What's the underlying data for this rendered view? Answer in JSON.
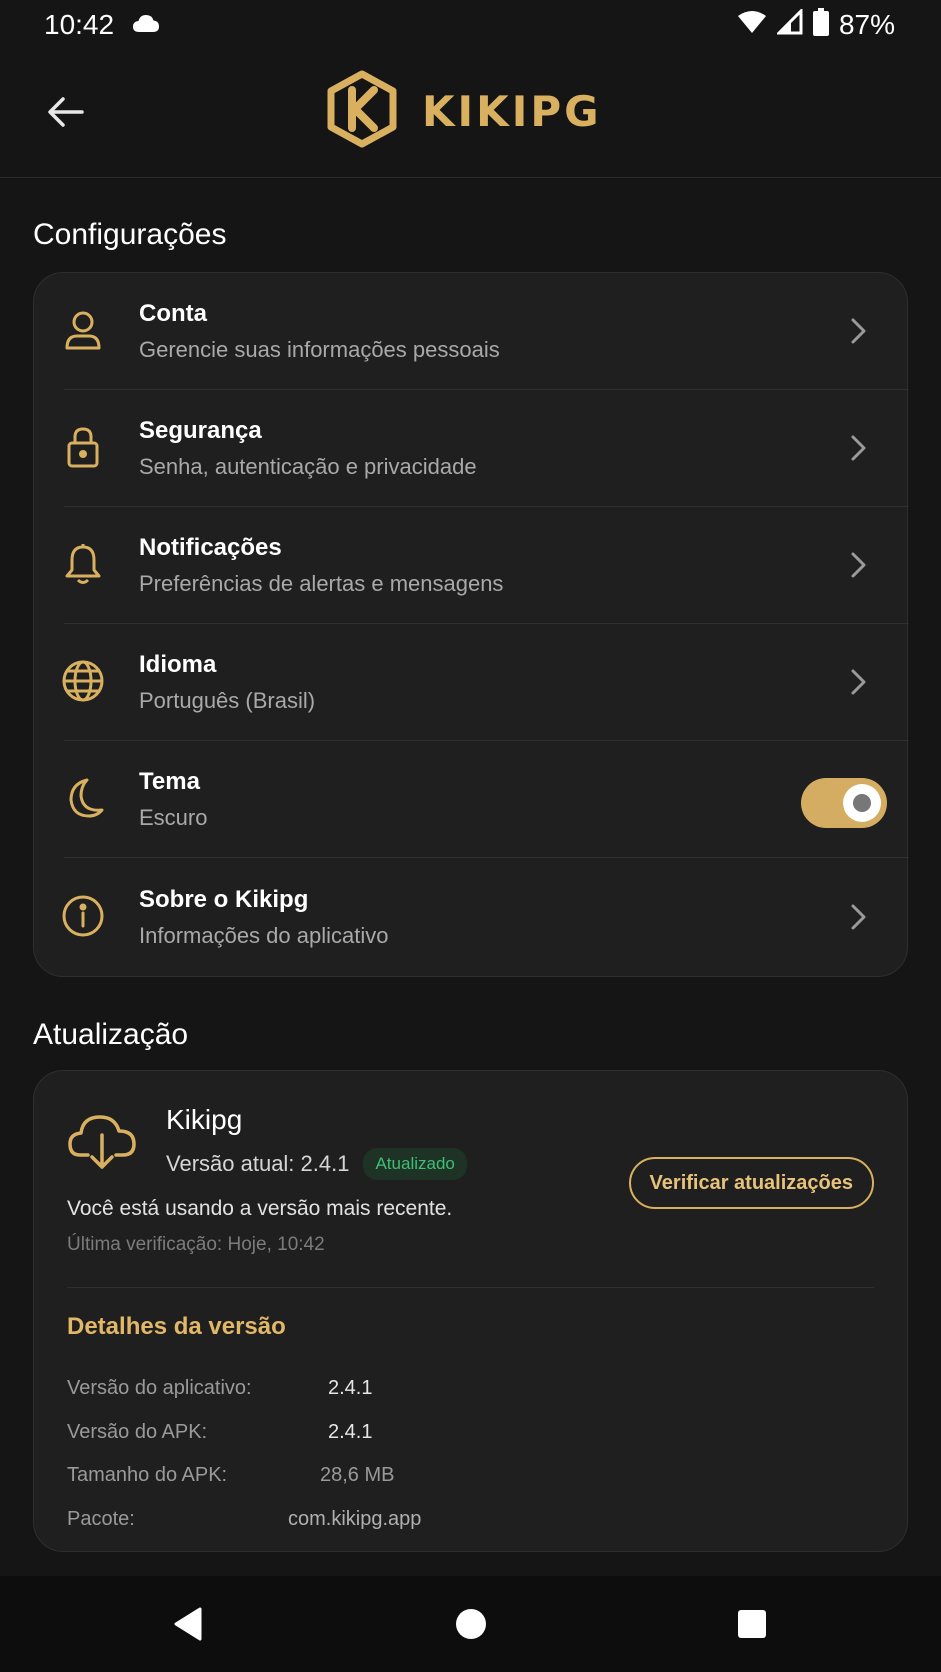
{
  "status_bar": {
    "time": "10:42",
    "battery": "87%"
  },
  "app_bar": {
    "brand": "KIKIPG"
  },
  "settings": {
    "section_title": "Configurações",
    "items": [
      {
        "title": "Conta",
        "subtitle": "Gerencie suas informações pessoais",
        "icon": "user-icon"
      },
      {
        "title": "Segurança",
        "subtitle": "Senha, autenticação e privacidade",
        "icon": "lock-icon"
      },
      {
        "title": "Notificações",
        "subtitle": "Preferências de alertas e mensagens",
        "icon": "bell-icon"
      },
      {
        "title": "Idioma",
        "subtitle": "Português (Brasil)",
        "icon": "globe-icon"
      },
      {
        "title": "Tema",
        "subtitle": "Escuro",
        "icon": "moon-icon",
        "toggle_on": true
      },
      {
        "title": "Sobre o Kikipg",
        "subtitle": "Informações do aplicativo",
        "icon": "info-icon"
      }
    ]
  },
  "update": {
    "section_title": "Atualização",
    "app_name": "Kikipg",
    "current_version": "Versão atual: 2.4.1",
    "badge": "Atualizado",
    "check_button": "Verificar atualizações",
    "message": "Você está usando a versão mais recente.",
    "last_check": "Última verificação: Hoje, 10:42",
    "details_title": "Detalhes da versão",
    "details": [
      {
        "label": "Versão do aplicativo:",
        "value": "2.4.1"
      },
      {
        "label": "Versão do APK:",
        "value": "2.4.1"
      },
      {
        "label": "Tamanho do APK:",
        "value": "28,6 MB"
      },
      {
        "label": "Pacote:",
        "value": "com.kikipg.app"
      }
    ]
  },
  "colors": {
    "accent": "#d9b060",
    "background": "#151515",
    "card": "#1f1f1f",
    "success": "#3fbf73"
  }
}
